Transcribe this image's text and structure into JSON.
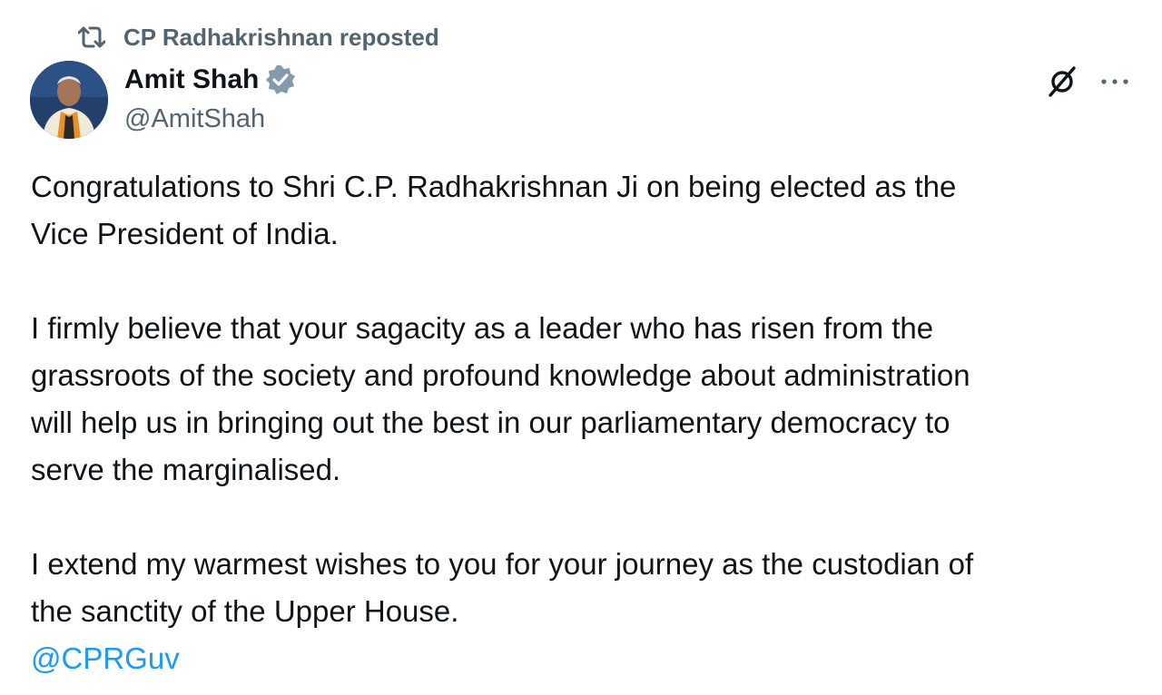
{
  "repost": {
    "icon": "repost-icon",
    "text": "CP Radhakrishnan reposted"
  },
  "author": {
    "name": "Amit Shah",
    "handle": "@AmitShah",
    "verified_icon": "verified-badge-icon",
    "avatar": "profile-avatar"
  },
  "actions": {
    "grok_icon": "grok-icon",
    "more_icon": "more-options-icon"
  },
  "post": {
    "lines_p1": [
      "Congratulations to Shri C.P. Radhakrishnan Ji on being elected as the",
      "Vice President of India."
    ],
    "lines_p2": [
      "I firmly believe that your sagacity as a leader who has risen from the",
      "grassroots of the society and profound knowledge about administration",
      "will help us in bringing out the best in our parliamentary democracy to",
      "serve the marginalised."
    ],
    "lines_p3": [
      "I extend my warmest wishes to you for your journey as the custodian of",
      "the sanctity of the Upper House."
    ],
    "mention": "@CPRGuv"
  },
  "colors": {
    "text": "#0f1419",
    "secondary": "#536471",
    "link": "#1d9bf0",
    "verified": "#829aab"
  }
}
